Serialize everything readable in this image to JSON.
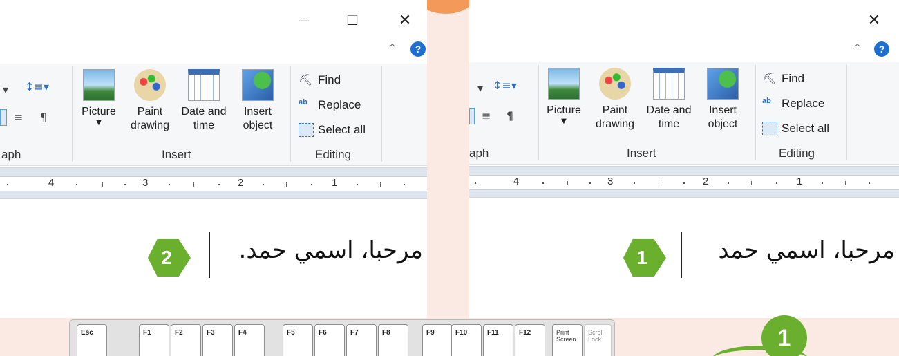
{
  "window_controls": {
    "minimize": "—",
    "maximize": "☐",
    "close": "✕"
  },
  "ribbon": {
    "insert": {
      "picture": "Picture",
      "paint_line1": "Paint",
      "paint_line2": "drawing",
      "date_line1": "Date and",
      "date_line2": "time",
      "object_line1": "Insert",
      "object_line2": "object",
      "group": "Insert"
    },
    "editing": {
      "find": "Find",
      "replace": "Replace",
      "select_all": "Select all",
      "group": "Editing"
    },
    "paragraph_fragment": "aph"
  },
  "ruler_numbers": [
    "4",
    "3",
    "2",
    "1"
  ],
  "document": {
    "left_text": "مرحبا، اسمي حمد.",
    "right_text": "مرحبا، اسمي حمد"
  },
  "steps": {
    "left": "2",
    "right": "1",
    "corner": "1"
  },
  "keyboard": {
    "keys": [
      "Esc",
      "F1",
      "F2",
      "F3",
      "F4",
      "F5",
      "F6",
      "F7",
      "F8",
      "F9",
      "F10",
      "F11",
      "F12"
    ],
    "print_screen_line1": "Print",
    "print_screen_line2": "Screen",
    "scroll_lock_line1": "Scroll",
    "scroll_lock_line2": "Lock"
  },
  "colors": {
    "accent_green": "#6ab02e",
    "orange": "#f39a5a",
    "help_blue": "#1e6fd1"
  }
}
